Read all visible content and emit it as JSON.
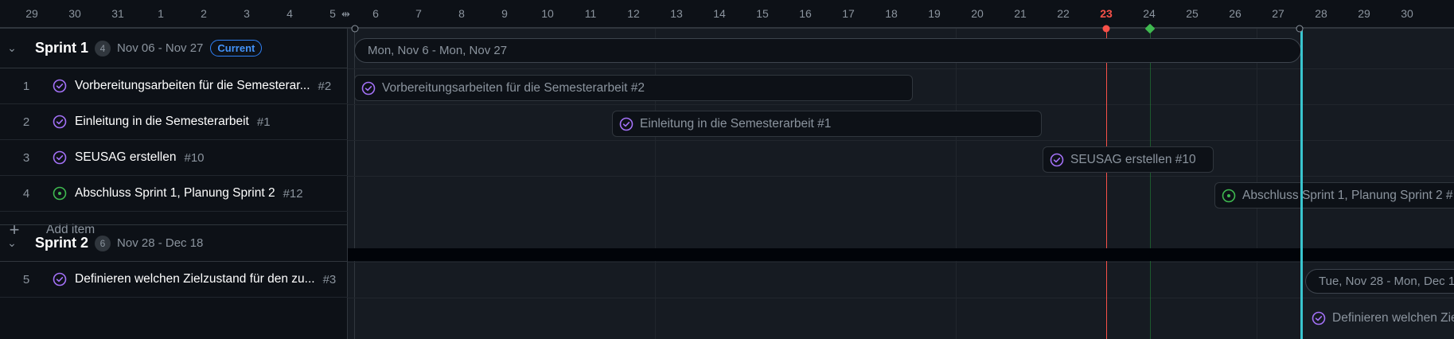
{
  "ruler": {
    "days": [
      "29",
      "30",
      "31",
      "1",
      "2",
      "3",
      "4",
      "5",
      "6",
      "7",
      "8",
      "9",
      "10",
      "11",
      "12",
      "13",
      "14",
      "15",
      "16",
      "17",
      "18",
      "19",
      "20",
      "21",
      "22",
      "23",
      "24",
      "25",
      "26",
      "27",
      "28",
      "29",
      "30"
    ],
    "today": "23",
    "resize_icon": "resize-horizontal-icon"
  },
  "colors": {
    "today": "#f85149",
    "marker_green": "#3fb950",
    "iteration_boundary": "#39c5cf",
    "status_done": "#a371f7",
    "status_open": "#3fb950",
    "current_badge": "#4493f8"
  },
  "groups": [
    {
      "title": "Sprint 1",
      "count": "4",
      "dates": "Nov 06 - Nov 27",
      "badge": "Current",
      "iteration_bar": "Mon, Nov 6 - Mon, Nov 27",
      "items": [
        {
          "num": "1",
          "title": "Vorbereitungsarbeiten für die Semesterar...",
          "ref": "#2",
          "status": "done",
          "bar": "Vorbereitungsarbeiten für die Semesterarbeit #2"
        },
        {
          "num": "2",
          "title": "Einleitung in die Semesterarbeit",
          "ref": "#1",
          "status": "done",
          "bar": "Einleitung in die Semesterarbeit #1"
        },
        {
          "num": "3",
          "title": "SEUSAG erstellen",
          "ref": "#10",
          "status": "done",
          "bar": "SEUSAG erstellen #10"
        },
        {
          "num": "4",
          "title": "Abschluss Sprint 1, Planung Sprint 2",
          "ref": "#12",
          "status": "open",
          "bar": "Abschluss Sprint 1, Planung Sprint 2 #"
        }
      ],
      "add_item": "Add item"
    },
    {
      "title": "Sprint 2",
      "count": "6",
      "dates": "Nov 28 - Dec 18",
      "iteration_bar": "Tue, Nov 28 - Mon, Dec 1",
      "items": [
        {
          "num": "5",
          "title": "Definieren welchen Zielzustand für den zu...",
          "ref": "#3",
          "status": "done",
          "bar": "Definieren welchen Zie"
        }
      ]
    }
  ]
}
